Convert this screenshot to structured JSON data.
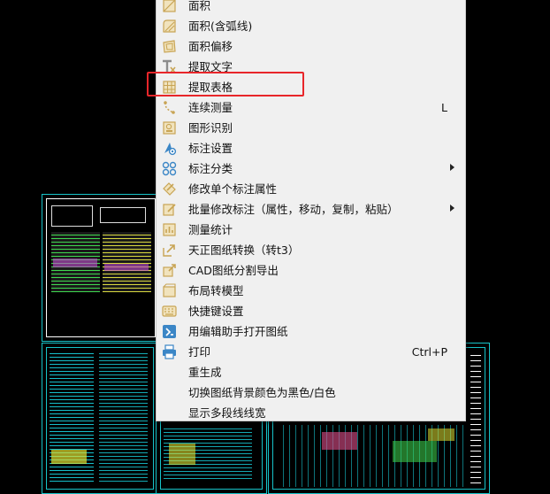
{
  "menu": {
    "items": [
      {
        "label": "面积",
        "icon": "area-icon",
        "shortcut": "",
        "submenu": false
      },
      {
        "label": "面积(含弧线)",
        "icon": "area-arc-icon",
        "shortcut": "",
        "submenu": false
      },
      {
        "label": "面积偏移",
        "icon": "area-offset-icon",
        "shortcut": "",
        "submenu": false
      },
      {
        "label": "提取文字",
        "icon": "extract-text-icon",
        "shortcut": "",
        "submenu": false
      },
      {
        "label": "提取表格",
        "icon": "extract-table-icon",
        "shortcut": "",
        "submenu": false
      },
      {
        "label": "连续测量",
        "icon": "continuous-measure-icon",
        "shortcut": "L",
        "submenu": false
      },
      {
        "label": "图形识别",
        "icon": "shape-recognition-icon",
        "shortcut": "",
        "submenu": false
      },
      {
        "label": "标注设置",
        "icon": "annotation-settings-icon",
        "shortcut": "",
        "submenu": false
      },
      {
        "label": "标注分类",
        "icon": "annotation-category-icon",
        "shortcut": "",
        "submenu": true
      },
      {
        "label": "修改单个标注属性",
        "icon": "edit-annotation-icon",
        "shortcut": "",
        "submenu": false
      },
      {
        "label": "批量修改标注（属性，移动，复制，粘贴）",
        "icon": "batch-edit-icon",
        "shortcut": "",
        "submenu": true
      },
      {
        "label": "测量统计",
        "icon": "measure-stats-icon",
        "shortcut": "",
        "submenu": false
      },
      {
        "label": "天正图纸转换（转t3）",
        "icon": "tangent-convert-icon",
        "shortcut": "",
        "submenu": false
      },
      {
        "label": "CAD图纸分割导出",
        "icon": "split-export-icon",
        "shortcut": "",
        "submenu": false
      },
      {
        "label": "布局转模型",
        "icon": "layout-to-model-icon",
        "shortcut": "",
        "submenu": false
      },
      {
        "label": "快捷键设置",
        "icon": "keyboard-icon",
        "shortcut": "",
        "submenu": false
      },
      {
        "label": "用编辑助手打开图纸",
        "icon": "edit-assistant-icon",
        "shortcut": "",
        "submenu": false
      },
      {
        "label": "打印",
        "icon": "print-icon",
        "shortcut": "Ctrl+P",
        "submenu": false
      },
      {
        "label": "重生成",
        "icon": "",
        "shortcut": "",
        "submenu": false
      },
      {
        "label": "切换图纸背景颜色为黑色/白色",
        "icon": "",
        "shortcut": "",
        "submenu": false
      },
      {
        "label": "显示多段线线宽",
        "icon": "",
        "shortcut": "",
        "submenu": false
      }
    ]
  },
  "colors": {
    "menu_bg": "#f0f0f0",
    "icon_gold": "#c8a454",
    "icon_blue": "#3b86c6",
    "highlight": "#e8262a",
    "cad_cyan": "#17c3c9"
  }
}
